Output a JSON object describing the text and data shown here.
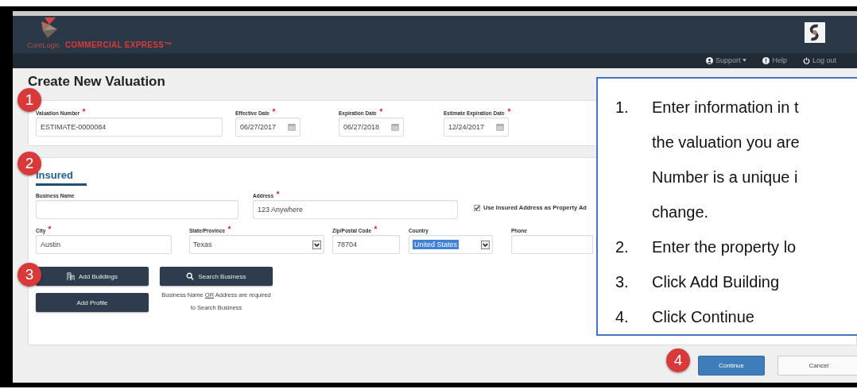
{
  "header": {
    "brand": "CoreLogic",
    "product": "COMMERCIAL EXPRESS™",
    "nav": [
      {
        "label": "Support",
        "has_menu": true
      },
      {
        "label": "Help",
        "has_menu": false
      },
      {
        "label": "Log out",
        "has_menu": false
      }
    ]
  },
  "page_title": "Create New Valuation",
  "valuation": {
    "badge": "1",
    "fields": [
      {
        "label": "Valuation Number",
        "required": true,
        "kind": "text",
        "value": "ESTIMATE-0000084"
      },
      {
        "label": "Effective Date",
        "required": true,
        "kind": "date",
        "value": "06/27/2017"
      },
      {
        "label": "Expiration Date",
        "required": true,
        "kind": "date",
        "value": "06/27/2018"
      },
      {
        "label": "Estimate Expiration Date",
        "required": true,
        "kind": "date",
        "value": "12/24/2017"
      }
    ]
  },
  "insured": {
    "badge": "2",
    "tab": "Insured",
    "row_1": [
      {
        "label": "Business Name",
        "required": false,
        "kind": "text"
      },
      {
        "label": "Address",
        "required": true,
        "kind": "text",
        "value": "123 Anywhere"
      }
    ],
    "checkbox": {
      "label": "Use Insured Address as Property Ad",
      "checked": true
    },
    "row_2": [
      {
        "label": "City",
        "required": true,
        "kind": "text",
        "value": "Austin"
      },
      {
        "label": "State/Province",
        "required": true,
        "kind": "select",
        "value": "Texas",
        "highlighted": false
      },
      {
        "label": "Zip/Postal Code",
        "required": true,
        "kind": "text",
        "value": "78704"
      },
      {
        "label": "Country",
        "required": false,
        "kind": "select",
        "value": "United States",
        "highlighted": true
      },
      {
        "label": "Phone",
        "required": false,
        "kind": "text"
      }
    ]
  },
  "actions": {
    "badge": "3",
    "buttons": [
      {
        "label": "Add Buildings"
      },
      {
        "label": "Search Business"
      },
      {
        "label": "Add Profile"
      }
    ],
    "note": {
      "before": "Business Name",
      "emphasis": "OR",
      "after": "Address are required to Search Business"
    }
  },
  "footer": {
    "badge": "4",
    "buttons": [
      {
        "label": "Continue",
        "kind": "primary"
      },
      {
        "label": "Cancel",
        "kind": "secondary"
      }
    ]
  },
  "callout": {
    "steps": [
      {
        "number": "1.",
        "lines": [
          "Enter information in t",
          "the valuation you are",
          "Number is a unique i",
          "change."
        ]
      },
      {
        "number": "2.",
        "lines": [
          "Enter the property lo"
        ]
      },
      {
        "number": "3.",
        "lines": [
          "Click Add Building"
        ]
      },
      {
        "number": "4.",
        "lines": [
          "Click Continue"
        ]
      }
    ]
  }
}
